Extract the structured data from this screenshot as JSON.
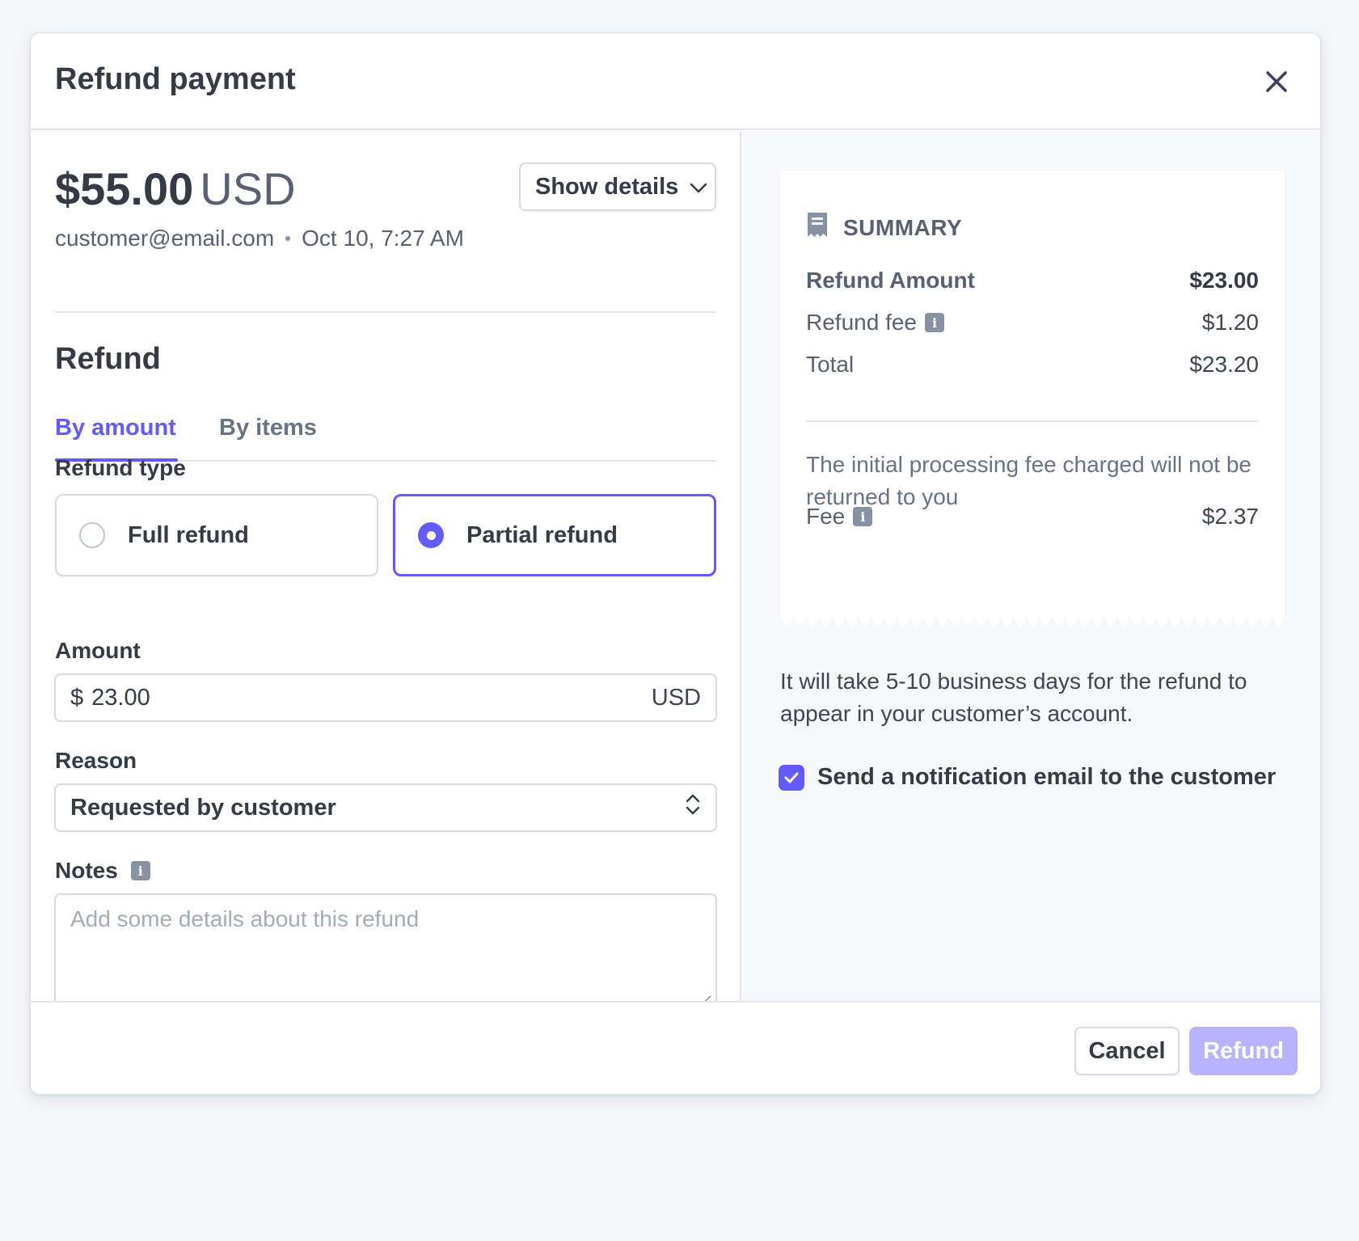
{
  "modal": {
    "title": "Refund payment",
    "close_icon": "close-icon"
  },
  "payment": {
    "amount": "$55.00",
    "currency": "USD",
    "show_details_label": "Show details",
    "customer_email": "customer@email.com",
    "date": "Oct 10, 7:27 AM"
  },
  "refund": {
    "section_title": "Refund",
    "tabs": [
      {
        "label": "By amount",
        "active": true
      },
      {
        "label": "By items",
        "active": false
      }
    ],
    "refund_type_label": "Refund type",
    "options": [
      {
        "label": "Full refund",
        "selected": false
      },
      {
        "label": "Partial refund",
        "selected": true
      }
    ],
    "amount_label": "Amount",
    "amount_prefix": "$",
    "amount_value": "23.00",
    "amount_suffix": "USD",
    "reason_label": "Reason",
    "reason_value": "Requested by customer",
    "notes_label": "Notes",
    "notes_placeholder": "Add some details about this refund"
  },
  "summary": {
    "title": "SUMMARY",
    "rows": [
      {
        "label": "Refund Amount",
        "value": "$23.00"
      },
      {
        "label": "Refund fee",
        "value": "$1.20"
      },
      {
        "label": "Total",
        "value": "$23.20"
      }
    ],
    "fee_note": "The initial processing fee charged will not be returned to you",
    "fee_label": "Fee",
    "fee_value": "$2.37"
  },
  "info": {
    "refund_time": "It will take 5-10 business days for the refund to appear in your customer’s account.",
    "notify_label": "Send a notification email to the customer",
    "notify_checked": true
  },
  "footer": {
    "cancel_label": "Cancel",
    "refund_label": "Refund"
  },
  "colors": {
    "accent": "#635bff",
    "accent_disabled": "#b7b3ff",
    "text_primary": "#353a44",
    "text_secondary": "#596171"
  }
}
